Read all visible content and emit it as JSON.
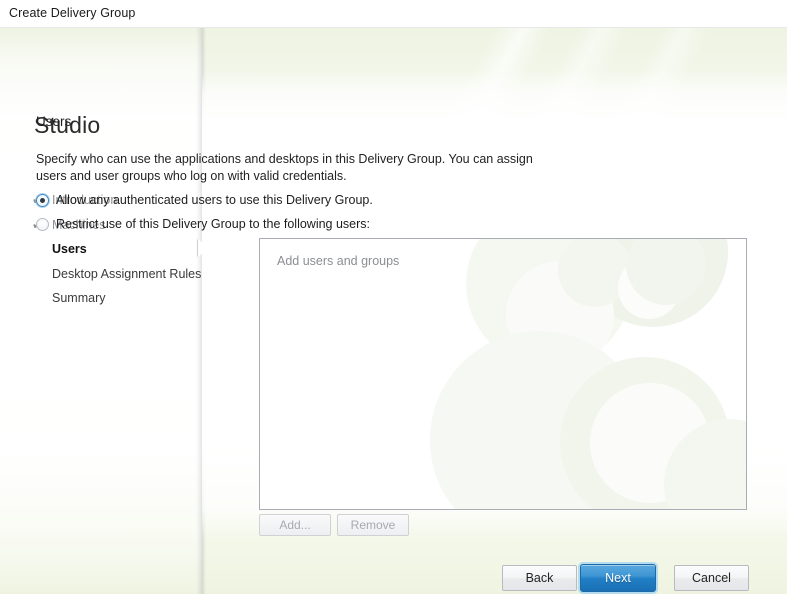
{
  "window": {
    "title": "Create Delivery Group"
  },
  "sidebar": {
    "logo": "Studio",
    "steps": [
      {
        "label": "Introduction",
        "state": "done",
        "check": "✔"
      },
      {
        "label": "Machines",
        "state": "done",
        "check": "✔"
      },
      {
        "label": "Users",
        "state": "active",
        "check": ""
      },
      {
        "label": "Desktop Assignment Rules",
        "state": "pending",
        "check": ""
      },
      {
        "label": "Summary",
        "state": "pending",
        "check": ""
      }
    ]
  },
  "main": {
    "title": "Users",
    "description": "Specify who can use the applications and desktops in this Delivery Group. You can assign users and user groups who log on with valid credentials.",
    "options": [
      {
        "label": "Allow any authenticated users to use this Delivery Group.",
        "selected": true
      },
      {
        "label": "Restrict use of this Delivery Group to the following users:",
        "selected": false
      }
    ],
    "listbox": {
      "placeholder": "Add users and groups",
      "items": []
    },
    "list_buttons": {
      "add_label": "Add...",
      "add_enabled": false,
      "remove_label": "Remove",
      "remove_enabled": false
    }
  },
  "footer": {
    "back_label": "Back",
    "next_label": "Next",
    "cancel_label": "Cancel"
  },
  "colors": {
    "accent_blue": "#2280c6",
    "page_green": "#eef3e2",
    "muted_text": "#8d9094",
    "border_gray": "#a9adb3"
  }
}
